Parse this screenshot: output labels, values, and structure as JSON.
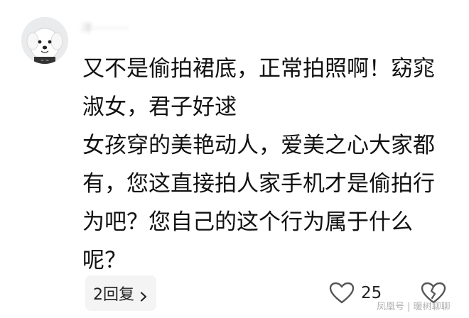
{
  "comment": {
    "username": "洋··········",
    "body_lines": [
      "又不是偷拍裙底，正常拍照啊！窈窕",
      "淑女，君子好逑",
      "女孩穿的美艳动人，爱美之心大家都",
      "有，您这直接拍人家手机才是偷拍行",
      "为吧？您自己的这个行为属于什么",
      "呢？"
    ],
    "reply_label": "2回复",
    "like_count": "25",
    "avatar_icon": "white-dog-avatar-icon",
    "like_icon": "heart-outline-icon",
    "dislike_icon": "broken-heart-icon",
    "reply_chevron_icon": "chevron-right-icon"
  },
  "watermark": "凤凰号 | 暖树聊聊"
}
